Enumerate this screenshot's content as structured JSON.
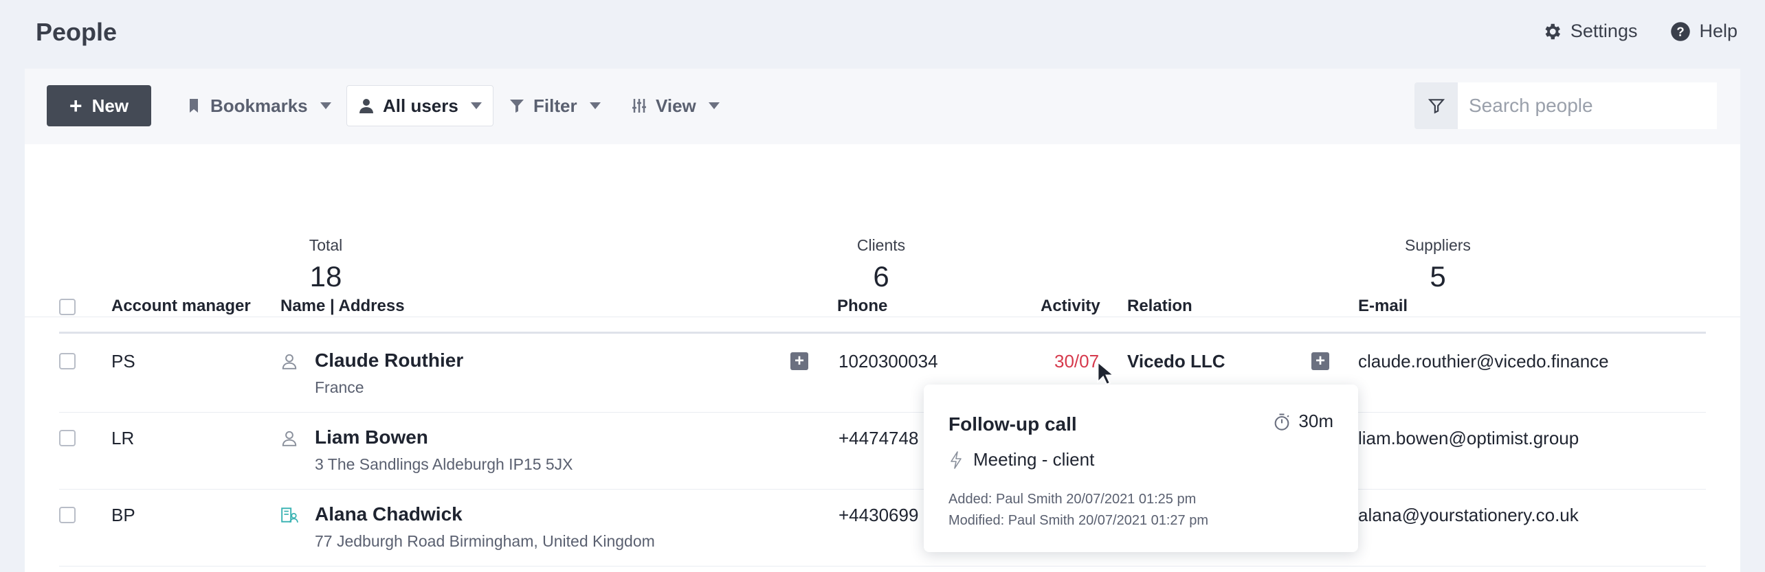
{
  "header": {
    "title": "People",
    "settings_label": "Settings",
    "help_label": "Help"
  },
  "toolbar": {
    "new_label": "New",
    "bookmarks_label": "Bookmarks",
    "all_users_label": "All users",
    "filter_label": "Filter",
    "view_label": "View",
    "search_placeholder": "Search people"
  },
  "stats": [
    {
      "label": "Total",
      "value": "18"
    },
    {
      "label": "Clients",
      "value": "6"
    },
    {
      "label": "Suppliers",
      "value": "5"
    }
  ],
  "table": {
    "columns": [
      "Account manager",
      "Name | Address",
      "Phone",
      "Activity",
      "Relation",
      "E-mail"
    ],
    "rows": [
      {
        "manager": "PS",
        "name": "Claude Routhier",
        "address": "France",
        "phone": "1020300034",
        "activity": "30/07",
        "relation": "Vicedo LLC",
        "email": "claude.routhier@vicedo.finance",
        "type_icon": "person-icon"
      },
      {
        "manager": "LR",
        "name": "Liam Bowen",
        "address": "3 The Sandlings Aldeburgh IP15 5JX",
        "phone": "+4474748",
        "activity": "",
        "relation": "",
        "email": "liam.bowen@optimist.group",
        "type_icon": "person-icon"
      },
      {
        "manager": "BP",
        "name": "Alana Chadwick",
        "address": "77 Jedburgh Road Birmingham, United Kingdom",
        "phone": "+4430699",
        "activity": "",
        "relation": "",
        "email": "alana@yourstationery.co.uk",
        "type_icon": "company-contact-icon"
      }
    ]
  },
  "tooltip": {
    "title": "Follow-up call",
    "duration": "30m",
    "type": "Meeting - client",
    "added": "Added: Paul Smith 20/07/2021 01:25 pm",
    "modified": "Modified: Paul Smith 20/07/2021 01:27 pm"
  },
  "colors": {
    "accent_dark": "#444a55",
    "activity_overdue": "#d6394c",
    "company_icon": "#3bb3b3",
    "background": "#eef1f7"
  }
}
